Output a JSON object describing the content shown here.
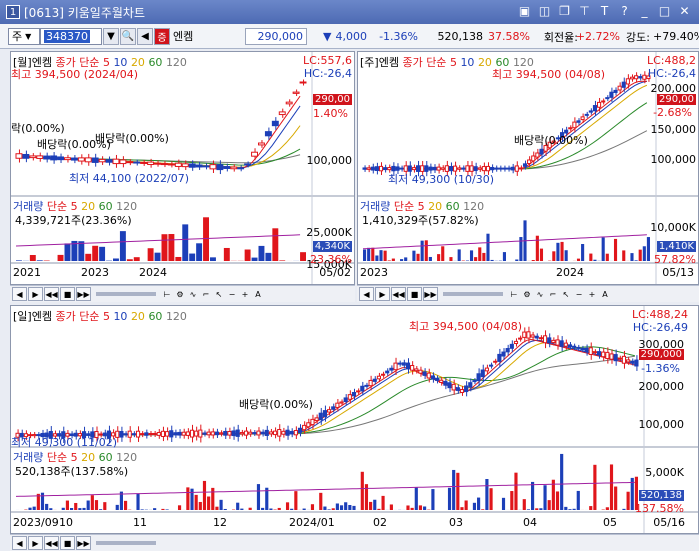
{
  "window": {
    "num": "1",
    "title": "[0613] 키움일주월차트"
  },
  "titlebar_icons": [
    "window-icon",
    "tile-icon",
    "pin-icon",
    "help-t-icon",
    "question-icon",
    "minimize-icon",
    "maximize-icon",
    "close-icon"
  ],
  "toolbar": {
    "market": "주",
    "code": "348370",
    "stock_name": "엔켐",
    "price": "290,000",
    "change": "4,000",
    "change_pct": "-1.36%",
    "volume": "520,138",
    "vol_ratio": "37.58%",
    "turnover_label": "회전율:",
    "turnover": "+2.72%",
    "strength_label": "강도:",
    "strength": "+79.40%"
  },
  "monthly": {
    "header": "[월]엔켐",
    "ma_label": "종가 단순",
    "ma": [
      "5",
      "10",
      "20",
      "60",
      "120"
    ],
    "lc": "LC:557,6",
    "hc": "HC:-26,4",
    "high": "최고 394,500 (2024/04)",
    "low": "최저 44,100 (2022/07)",
    "div1": "배당락(0.00%)",
    "div2": "배당락(0.00%)",
    "div3": "락(0.00%)",
    "price_tag": "290,00",
    "pct": "1.40%",
    "grid": [
      "100,000"
    ],
    "vol_header": "거래량",
    "vol_ma_label": "단순",
    "vol_ma": [
      "5",
      "20",
      "60",
      "120"
    ],
    "vol_value": "4,339,721주(23.36%)",
    "vol_grid": [
      "25,000K",
      "15,000K"
    ],
    "vol_tag": "4,340K",
    "vol_pct": "23.36%",
    "xlabels": [
      "2021",
      "2023",
      "2024",
      "05/02"
    ]
  },
  "weekly": {
    "header": "[주]엔켐",
    "ma_label": "종가 단순",
    "ma": [
      "5",
      "10",
      "20",
      "60",
      "120"
    ],
    "lc": "LC:488,2",
    "hc": "HC:-26,4",
    "high": "최고 394,500 (04/08)",
    "low": "최저 49,300 (10/30)",
    "div": "배당락(0.00%)",
    "price_tag": "290,00",
    "pct": "-2.68%",
    "grid": [
      "200,000",
      "150,000",
      "100,000"
    ],
    "vol_header": "거래량",
    "vol_ma_label": "단순",
    "vol_ma": [
      "5",
      "20",
      "60",
      "120"
    ],
    "vol_value": "1,410,329주(57.82%)",
    "vol_grid": [
      "10,000K",
      "5,000K"
    ],
    "vol_tag": "1,410K",
    "vol_pct": "57.82%",
    "xlabels": [
      "2023",
      "2024",
      "05/13"
    ]
  },
  "daily": {
    "header": "[일]엔켐",
    "ma_label": "종가 단순",
    "ma": [
      "5",
      "10",
      "20",
      "60",
      "120"
    ],
    "lc": "LC:488,24",
    "hc": "HC:-26,49",
    "high": "최고 394,500 (04/08)",
    "low": "최저 49,300 (11/02)",
    "div": "배당락(0.00%)",
    "price_tag": "290,000",
    "pct": "-1.36%",
    "grid": [
      "300,000",
      "200,000",
      "100,000"
    ],
    "vol_header": "거래량",
    "vol_ma_label": "단순",
    "vol_ma": [
      "5",
      "20",
      "60",
      "120"
    ],
    "vol_value": "520,138주(137.58%)",
    "vol_grid": [
      "5,000K"
    ],
    "vol_tag": "520,138",
    "vol_pct": "137.58%",
    "xlabels": [
      "2023/09",
      "10",
      "11",
      "12",
      "2024/01",
      "02",
      "03",
      "04",
      "05",
      "05/16"
    ]
  },
  "colors": {
    "up": "#e0161b",
    "down": "#1c3fb8",
    "ma5": "#e0161b",
    "ma10": "#1c3fb8",
    "ma20": "#d8a900",
    "ma60": "#2a8a2a",
    "ma120": "#777777"
  }
}
